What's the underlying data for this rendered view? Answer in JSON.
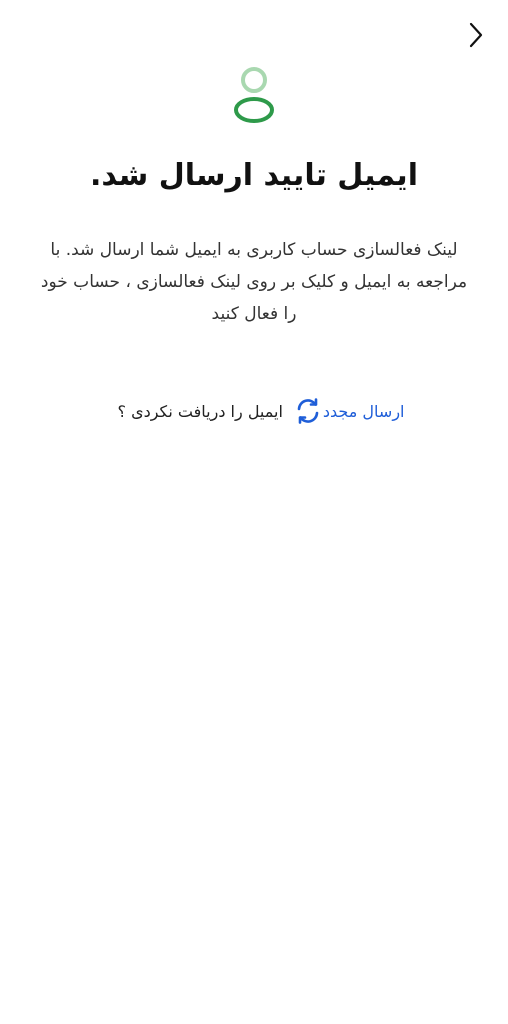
{
  "header": {
    "back_icon": "chevron-right-icon"
  },
  "hero": {
    "icon": "user-icon",
    "icon_color": "#2e9a4a"
  },
  "title": "ایمیل تایید ارسال شد.",
  "description": "لینک فعالسازی حساب کاربری به ایمیل شما ارسال شد. با مراجعه به ایمیل و کلیک بر روی لینک فعالسازی ، حساب خود را فعال کنید",
  "resend": {
    "question": "ایمیل را دریافت نکردی ؟",
    "icon": "refresh-icon",
    "link_label": "ارسال مجدد",
    "link_color": "#1f5ed8"
  }
}
